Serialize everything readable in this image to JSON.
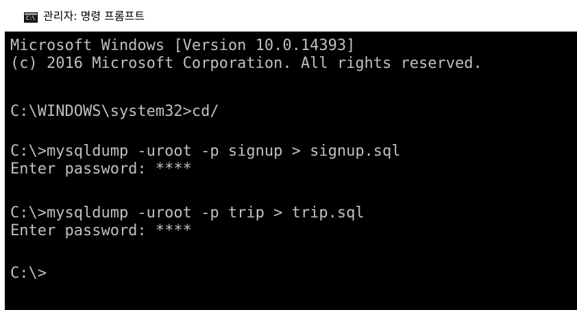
{
  "window": {
    "title": "관리자: 명령 프롬프트",
    "icon": "cmd-icon",
    "icon_glyph": "C:\\"
  },
  "console": {
    "lines": [
      "Microsoft Windows [Version 10.0.14393]",
      "(c) 2016 Microsoft Corporation. All rights reserved.",
      "",
      "C:\\WINDOWS\\system32>cd/",
      "",
      "C:\\>mysqldump -uroot -p signup > signup.sql",
      "Enter password: ****",
      "",
      "C:\\>mysqldump -uroot -p trip > trip.sql",
      "Enter password: ****",
      "",
      "C:\\>"
    ]
  },
  "colors": {
    "console_background": "#000000",
    "console_text": "#c0c0c0",
    "titlebar_background": "#ffffff"
  }
}
